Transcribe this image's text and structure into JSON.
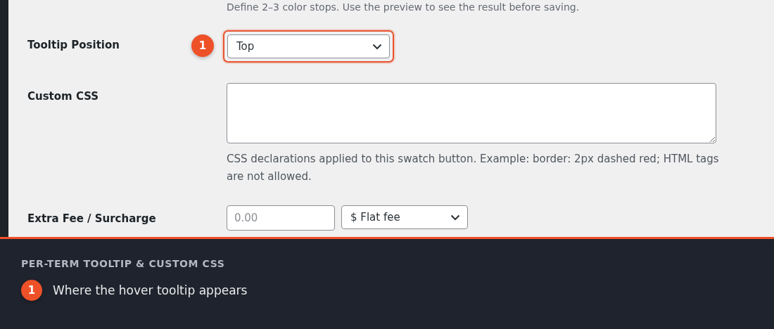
{
  "description": "Define 2–3 color stops. Use the preview to see the result before saving.",
  "fields": [
    {
      "kind": "select",
      "label": "Tooltip Position",
      "value": "Top",
      "callout": "1",
      "highlighted": true
    },
    {
      "kind": "textarea",
      "label": "Custom CSS",
      "help": "CSS declarations applied to this swatch button. Example: border: 2px dashed red; HTML tags are not allowed."
    },
    {
      "kind": "fee",
      "label": "Extra Fee / Surcharge",
      "placeholder": "0.00",
      "value": "$ Flat fee"
    }
  ],
  "callout_panel": {
    "title": "PER-TERM TOOLTIP & CUSTOM CSS",
    "items": [
      {
        "number": "1",
        "text": "Where the hover tooltip appears"
      }
    ]
  }
}
